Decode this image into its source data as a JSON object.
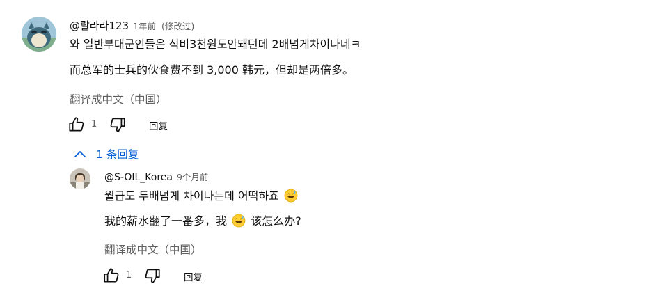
{
  "comment": {
    "author": "@랄라라123",
    "time": "1年前",
    "edited": "(修改过)",
    "text_line1": "와 일반부대군인들은 식비3천원도안돼던데 2배넘게차이나네ㅋ",
    "text_line2": "而总军的士兵的伙食费不到 3,000 韩元，但却是两倍多。",
    "translate_label": "翻译成中文（中国）",
    "like_count": "1",
    "reply_label": "回复",
    "replies_toggle_label": "1 条回复"
  },
  "reply": {
    "author": "@S-OIL_Korea",
    "time": "9个月前",
    "text_line1": "월급도 두배넘게 차이나는데 어떡하죠",
    "text_line2_before": "我的薪水翻了一番多，我",
    "text_line2_after": "该怎么办?",
    "translate_label": "翻译成中文（中国）",
    "like_count": "1",
    "reply_label": "回复"
  },
  "icons": {
    "like": "thumb-up-icon",
    "dislike": "thumb-down-icon",
    "chevron": "chevron-up-icon",
    "emoji": "sweat-smile-emoji-icon"
  },
  "colors": {
    "link_blue": "#065fd4",
    "secondary_text": "#606060",
    "primary_text": "#0f0f0f"
  }
}
